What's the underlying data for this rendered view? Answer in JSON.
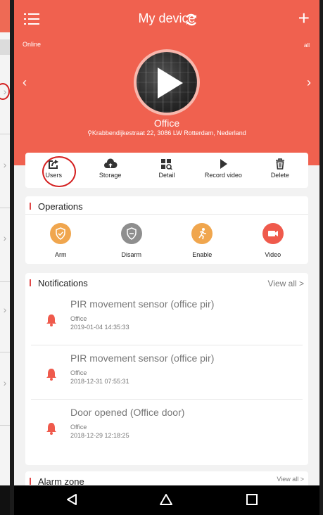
{
  "header": {
    "title": "My device",
    "status": "Online",
    "signal": "all"
  },
  "device": {
    "name": "Office",
    "address": "Krabbendijkestraat 22, 3086 LW Rotterdam, Nederland"
  },
  "actions": [
    {
      "label": "Users",
      "icon": "share-icon"
    },
    {
      "label": "Storage",
      "icon": "cloud-upload-icon"
    },
    {
      "label": "Detail",
      "icon": "detail-grid-icon"
    },
    {
      "label": "Record video",
      "icon": "play-icon"
    },
    {
      "label": "Delete",
      "icon": "trash-icon"
    }
  ],
  "operations": {
    "title": "Operations",
    "items": [
      {
        "label": "Arm",
        "icon": "shield-check-icon",
        "color": "#f0a64e"
      },
      {
        "label": "Disarm",
        "icon": "shield-minus-icon",
        "color": "#8e8e8e"
      },
      {
        "label": "Enable",
        "icon": "running-person-icon",
        "color": "#f0a64e"
      },
      {
        "label": "Video",
        "icon": "video-camera-icon",
        "color": "#ef5a4c"
      }
    ]
  },
  "notifications": {
    "title": "Notifications",
    "view_all": "View all >",
    "items": [
      {
        "title": "PIR movement sensor (office pir)",
        "location": "Office",
        "time": "2019-01-04 14:35:33"
      },
      {
        "title": "PIR movement sensor (office pir)",
        "location": "Office",
        "time": "2018-12-31 07:55:31"
      },
      {
        "title": "Door opened (Office door)",
        "location": "Office",
        "time": "2018-12-29 12:18:25"
      }
    ]
  },
  "alarm_zone": {
    "title": "Alarm zone",
    "view_all": "View all >"
  },
  "colors": {
    "brand": "#f0614f",
    "accent_red": "#e04848",
    "bell": "#ef5a4c"
  }
}
